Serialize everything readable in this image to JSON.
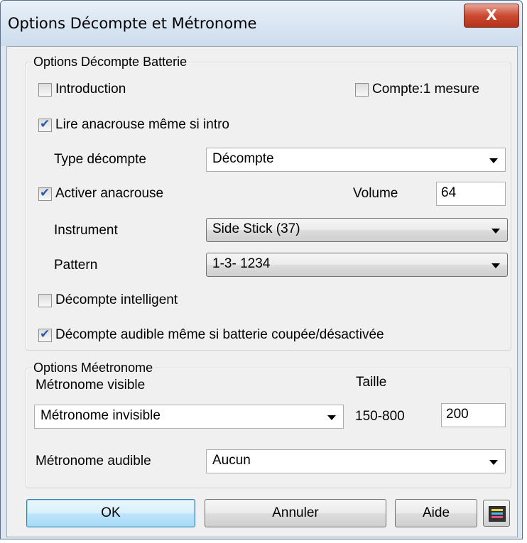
{
  "window": {
    "title": "Options Décompte et Métronome",
    "close_label": "X"
  },
  "drum": {
    "legend": "Options Décompte Batterie",
    "introduction": {
      "label": "Introduction",
      "checked": false
    },
    "count_one_bar": {
      "label": "Compte:1 mesure",
      "checked": false
    },
    "read_pickup": {
      "label": "Lire anacrouse même si intro",
      "checked": true
    },
    "count_type": {
      "label": "Type décompte",
      "value": "Décompte"
    },
    "activate_pickup": {
      "label": "Activer anacrouse",
      "checked": true
    },
    "volume": {
      "label": "Volume",
      "value": "64"
    },
    "instrument": {
      "label": "Instrument",
      "value": "Side Stick (37)"
    },
    "pattern": {
      "label": "Pattern",
      "value": "1-3- 1234"
    },
    "smart_count": {
      "label": "Décompte intelligent",
      "checked": false
    },
    "audible_count": {
      "label": "Décompte audible même si batterie coupée/désactivée",
      "checked": true
    }
  },
  "metronome": {
    "legend": "Options Méetronome",
    "visible_label": "Métronome visible",
    "visible_value": "Métronome invisible",
    "size_label": "Taille",
    "size_range": "150-800",
    "size_value": "200",
    "audible_label": "Métronome audible",
    "audible_value": "Aucun"
  },
  "buttons": {
    "ok": "OK",
    "cancel": "Annuler",
    "help": "Aide",
    "icon": "keyboard-icon"
  }
}
